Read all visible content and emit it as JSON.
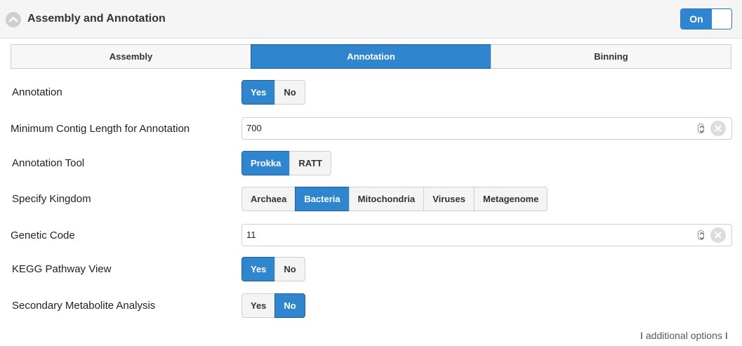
{
  "header": {
    "title": "Assembly and Annotation",
    "toggle_label": "On",
    "icons": [
      "chevron-up-icon"
    ]
  },
  "tabs": [
    {
      "label": "Assembly",
      "active": false
    },
    {
      "label": "Annotation",
      "active": true
    },
    {
      "label": "Binning",
      "active": false
    }
  ],
  "form": {
    "annotation": {
      "label": "Annotation",
      "options": [
        "Yes",
        "No"
      ],
      "selected": "Yes"
    },
    "min_contig": {
      "label": "Minimum Contig Length for Annotation",
      "value": "700"
    },
    "tool": {
      "label": "Annotation Tool",
      "options": [
        "Prokka",
        "RATT"
      ],
      "selected": "Prokka"
    },
    "kingdom": {
      "label": "Specify Kingdom",
      "options": [
        "Archaea",
        "Bacteria",
        "Mitochondria",
        "Viruses",
        "Metagenome"
      ],
      "selected": "Bacteria"
    },
    "genetic_code": {
      "label": "Genetic Code",
      "value": "11"
    },
    "kegg": {
      "label": "KEGG Pathway View",
      "options": [
        "Yes",
        "No"
      ],
      "selected": "Yes"
    },
    "secondary": {
      "label": "Secondary Metabolite Analysis",
      "options": [
        "Yes",
        "No"
      ],
      "selected": "No"
    }
  },
  "footer": {
    "additional_options": "additional options",
    "bar_left": "I",
    "bar_right": "I"
  },
  "colors": {
    "accent": "#2f86cf",
    "accent_border": "#245f96",
    "header_bg": "#f5f5f5"
  }
}
